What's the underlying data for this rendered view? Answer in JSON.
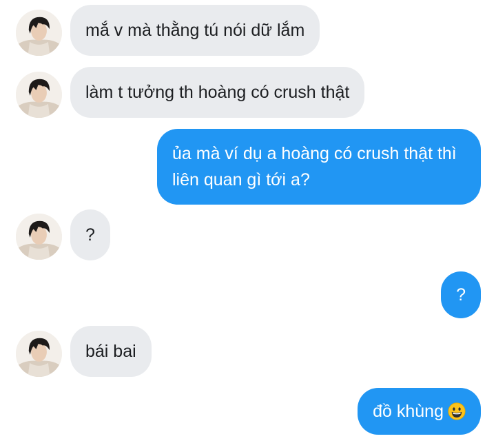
{
  "messages": [
    {
      "side": "incoming",
      "text": "mắ v mà thằng tú nói dữ lắm"
    },
    {
      "side": "incoming",
      "text": "làm t tưởng th hoàng có crush thật"
    },
    {
      "side": "outgoing",
      "lines": [
        "ủa mà ví dụ a hoàng có crush thật thì",
        "liên quan gì tới a?"
      ]
    },
    {
      "side": "incoming",
      "text": "?"
    },
    {
      "side": "outgoing",
      "text": "?"
    },
    {
      "side": "incoming",
      "text": "bái bai"
    },
    {
      "side": "outgoing",
      "text": "đồ khùng",
      "emoji": "grinning-face-emoji"
    }
  ],
  "colors": {
    "incoming_bubble": "#e9ebee",
    "outgoing_bubble": "#2196f3",
    "outgoing_text": "#ffffff",
    "incoming_text": "#1c1e21"
  }
}
